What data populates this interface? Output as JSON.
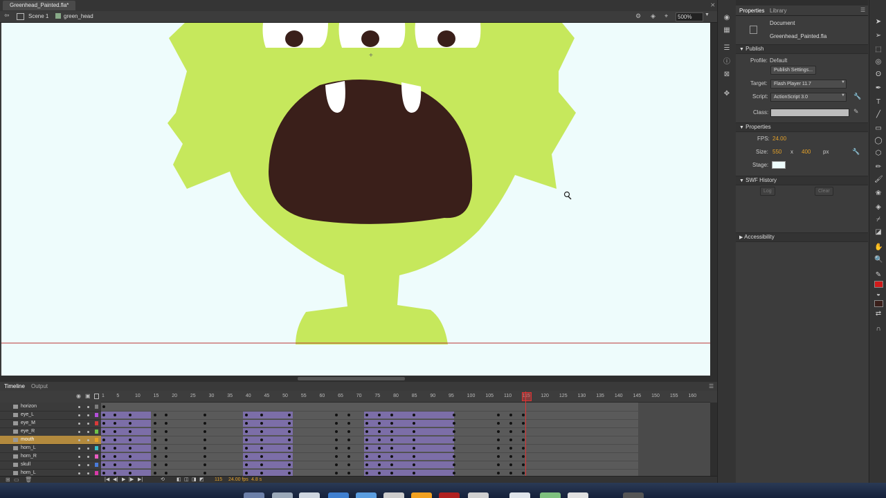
{
  "document_tab": {
    "title": "Greenhead_Painted.fla*",
    "close": "⨯"
  },
  "editbar": {
    "scene": "Scene 1",
    "symbol": "green_head",
    "zoom": "500%"
  },
  "stage": {
    "background": "#eefcfc",
    "head_color": "#c6e85c",
    "mouth_color": "#3a1f1a"
  },
  "timeline": {
    "tabs": [
      "Timeline",
      "Output"
    ],
    "ruler_ticks": [
      "1",
      "5",
      "10",
      "15",
      "20",
      "25",
      "30",
      "35",
      "40",
      "45",
      "50",
      "55",
      "60",
      "65",
      "70",
      "75",
      "80",
      "85",
      "90",
      "95",
      "100",
      "105",
      "110",
      "115",
      "120",
      "125",
      "130",
      "135",
      "140",
      "145",
      "150",
      "155",
      "160"
    ],
    "layers": [
      {
        "name": "horizon",
        "color": "#7d7d7d"
      },
      {
        "name": "eye_L",
        "color": "#b34fd9"
      },
      {
        "name": "eye_M",
        "color": "#d93a3a"
      },
      {
        "name": "eye_R",
        "color": "#6fc24a"
      },
      {
        "name": "mouth",
        "color": "#e5a229",
        "selected": true
      },
      {
        "name": "horn_L",
        "color": "#3ac0c9"
      },
      {
        "name": "horn_R",
        "color": "#e95cc1"
      },
      {
        "name": "skull",
        "color": "#4a7bd9"
      },
      {
        "name": "horn_L",
        "color": "#d93aa8"
      }
    ],
    "current_frame": "115",
    "fps": "24.00 fps",
    "elapsed": "4.8 s"
  },
  "properties": {
    "tabs": [
      "Properties",
      "Library"
    ],
    "doc_type": "Document",
    "doc_name": "Greenhead_Painted.fla",
    "publish": {
      "section": "Publish",
      "profile_label": "Profile:",
      "profile_value": "Default",
      "settings_button": "Publish Settings...",
      "target_label": "Target:",
      "target_value": "Flash Player 11.7",
      "script_label": "Script:",
      "script_value": "ActionScript 3.0",
      "class_label": "Class:"
    },
    "props": {
      "section": "Properties",
      "fps_label": "FPS:",
      "fps_value": "24.00",
      "size_label": "Size:",
      "width": "550",
      "x": "x",
      "height": "400",
      "unit": "px",
      "stage_label": "Stage:"
    },
    "swf_history": {
      "section": "SWF History",
      "log": "Log",
      "clear": "Clear"
    },
    "accessibility": {
      "section": "Accessibility"
    }
  }
}
